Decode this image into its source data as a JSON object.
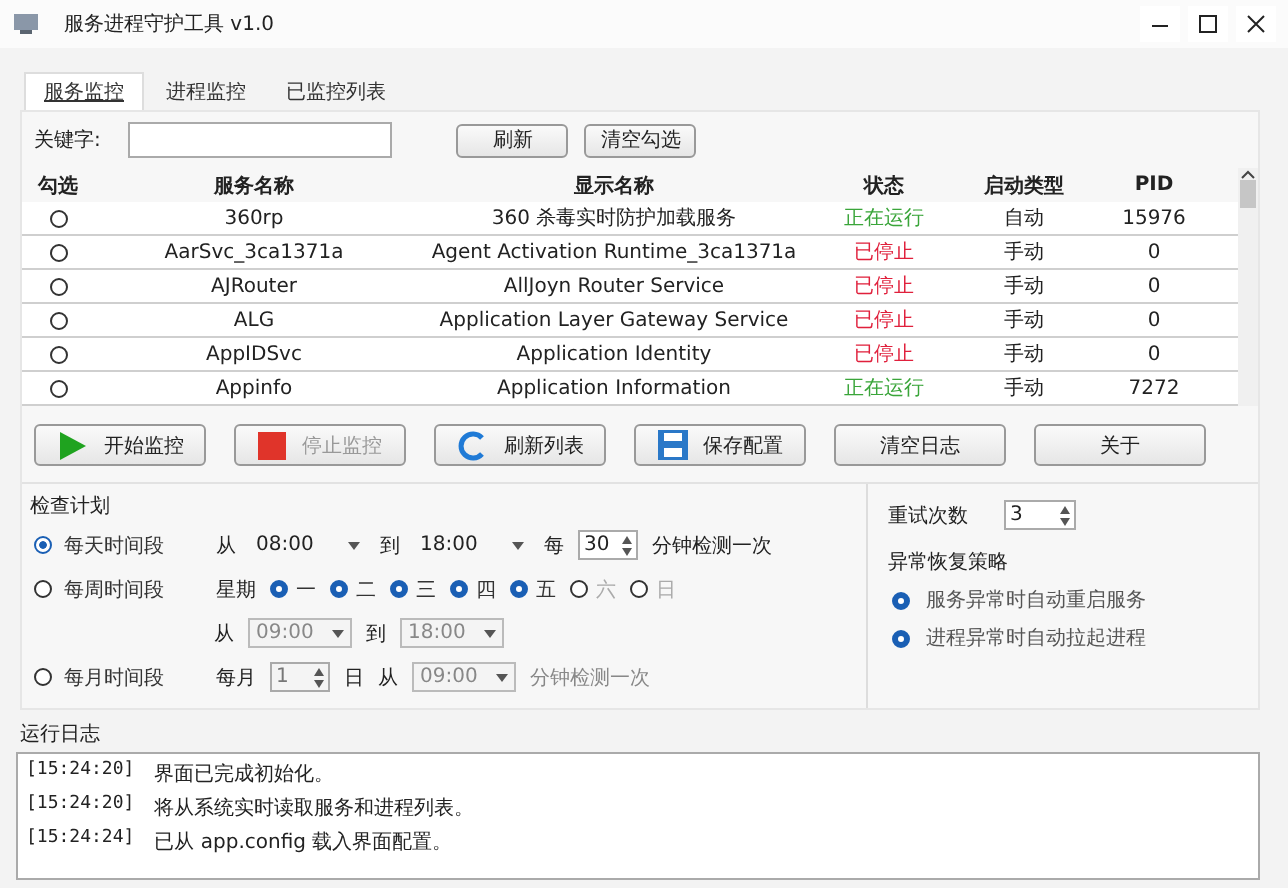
{
  "window": {
    "title": "服务进程守护工具 v1.0"
  },
  "tabs": [
    {
      "label": "服务监控",
      "selected": true
    },
    {
      "label": "进程监控",
      "selected": false
    },
    {
      "label": "已监控列表",
      "selected": false
    }
  ],
  "search": {
    "label": "关键字:",
    "buttons": [
      "刷新",
      "清空勾选"
    ]
  },
  "table": {
    "columns": [
      "勾选",
      "服务名称",
      "显示名称",
      "状态",
      "启动类型",
      "PID"
    ],
    "rows": [
      {
        "checked": false,
        "name": "360rp",
        "display": "360 杀毒实时防护加载服务",
        "status": "正在运行",
        "running": true,
        "start": "自动",
        "pid": "15976"
      },
      {
        "checked": false,
        "name": "AarSvc_3ca1371a",
        "display": "Agent Activation Runtime_3ca1371a",
        "status": "已停止",
        "running": false,
        "start": "手动",
        "pid": "0"
      },
      {
        "checked": false,
        "name": "AJRouter",
        "display": "AllJoyn Router Service",
        "status": "已停止",
        "running": false,
        "start": "手动",
        "pid": "0"
      },
      {
        "checked": false,
        "name": "ALG",
        "display": "Application Layer Gateway Service",
        "status": "已停止",
        "running": false,
        "start": "手动",
        "pid": "0"
      },
      {
        "checked": false,
        "name": "AppIDSvc",
        "display": "Application Identity",
        "status": "已停止",
        "running": false,
        "start": "手动",
        "pid": "0"
      },
      {
        "checked": false,
        "name": "Appinfo",
        "display": "Application Information",
        "status": "正在运行",
        "running": true,
        "start": "手动",
        "pid": "7272"
      }
    ]
  },
  "toolbar": [
    {
      "kind": "play",
      "label": "开始监控",
      "disabled": false
    },
    {
      "kind": "stop",
      "label": "停止监控",
      "disabled": true
    },
    {
      "kind": "refresh",
      "label": "刷新列表",
      "disabled": false
    },
    {
      "kind": "save",
      "label": "保存配置",
      "disabled": false
    },
    {
      "kind": "none",
      "label": "清空日志",
      "disabled": false
    },
    {
      "kind": "none",
      "label": "关于",
      "disabled": false
    }
  ],
  "schedule": {
    "title": "检查计划",
    "daily": {
      "label": "每天时间段",
      "selected": true,
      "from_label": "从",
      "from": "08:00",
      "to_label": "到",
      "to": "18:00",
      "every_label": "每",
      "every": "30",
      "suffix": "分钟检测一次"
    },
    "weekly": {
      "label": "每周时间段",
      "selected": false,
      "week_label": "星期",
      "days": [
        {
          "label": "一",
          "checked": true
        },
        {
          "label": "二",
          "checked": true
        },
        {
          "label": "三",
          "checked": true
        },
        {
          "label": "四",
          "checked": true
        },
        {
          "label": "五",
          "checked": true
        },
        {
          "label": "六",
          "checked": false
        },
        {
          "label": "日",
          "checked": false
        }
      ],
      "from_label": "从",
      "from": "09:00",
      "to_label": "到",
      "to": "18:00"
    },
    "monthly": {
      "label": "每月时间段",
      "selected": false,
      "month_label": "每月",
      "day": "1",
      "day_label": "日",
      "from_label": "从",
      "from": "09:00",
      "suffix": "分钟检测一次"
    }
  },
  "recovery": {
    "retry_label": "重试次数",
    "retry": "3",
    "strategy_title": "异常恢复策略",
    "options": [
      {
        "label": "服务异常时自动重启服务",
        "checked": true
      },
      {
        "label": "进程异常时自动拉起进程",
        "checked": true
      }
    ]
  },
  "log": {
    "title": "运行日志",
    "lines": [
      {
        "time": "[15:24:20]",
        "text": "界面已完成初始化。"
      },
      {
        "time": "[15:24:20]",
        "text": "将从系统实时读取服务和进程列表。"
      },
      {
        "time": "[15:24:24]",
        "text": "已从 app.config 载入界面配置。"
      }
    ]
  }
}
